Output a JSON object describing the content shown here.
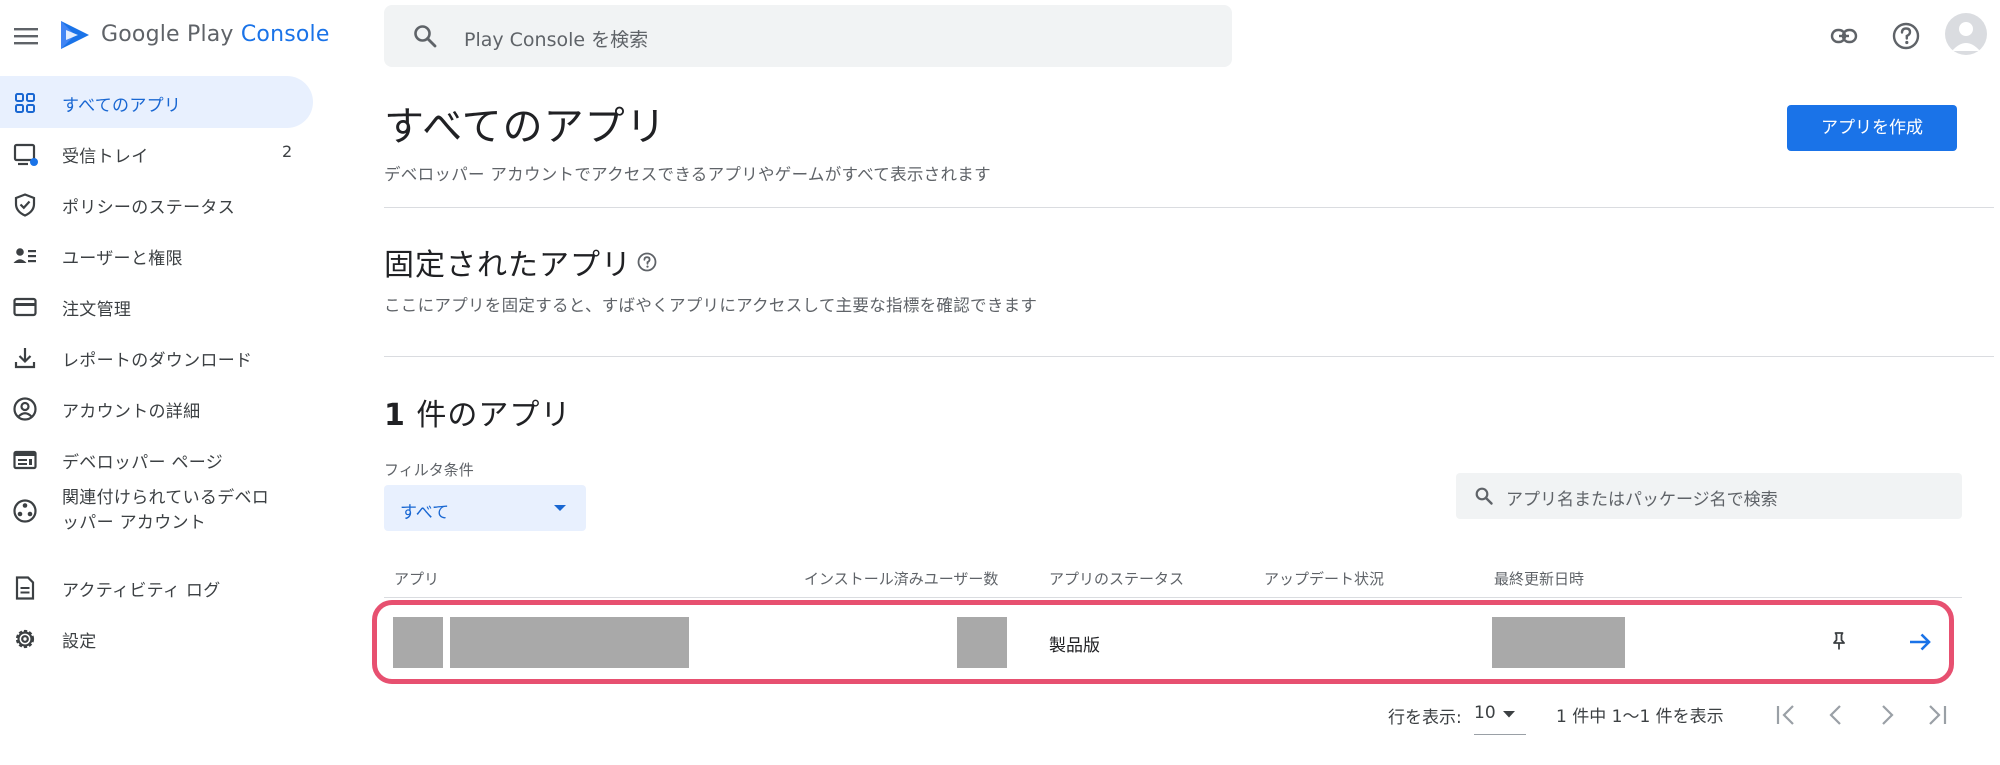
{
  "header": {
    "logo_text_main": "Google Play ",
    "logo_text_accent": "Console",
    "search_placeholder": "Play Console を検索"
  },
  "sidebar": {
    "items": [
      {
        "label": "すべてのアプリ",
        "icon": "grid-icon",
        "active": true
      },
      {
        "label": "受信トレイ",
        "icon": "inbox-icon",
        "badge": "2"
      },
      {
        "label": "ポリシーのステータス",
        "icon": "shield-check-icon"
      },
      {
        "label": "ユーザーと権限",
        "icon": "user-list-icon"
      },
      {
        "label": "注文管理",
        "icon": "credit-card-icon"
      },
      {
        "label": "レポートのダウンロード",
        "icon": "download-icon"
      },
      {
        "label": "アカウントの詳細",
        "icon": "account-circle-icon"
      },
      {
        "label": "デベロッパー ページ",
        "icon": "web-page-icon"
      },
      {
        "label_line1": "関連付けられているデベロ",
        "label_line2": "ッパー アカウント",
        "icon": "linked-accounts-icon"
      },
      {
        "label": "アクティビティ ログ",
        "icon": "document-icon"
      },
      {
        "label": "設定",
        "icon": "gear-icon"
      }
    ]
  },
  "main": {
    "title": "すべてのアプリ",
    "subtitle": "デベロッパー アカウントでアクセスできるアプリやゲームがすべて表示されます",
    "create_button": "アプリを作成",
    "pinned": {
      "title": "固定されたアプリ",
      "subtitle": "ここにアプリを固定すると、すばやくアプリにアクセスして主要な指標を確認できます"
    },
    "apps": {
      "count_title_num": "1",
      "count_title_text": "件のアプリ",
      "filter_label": "フィルタ条件",
      "filter_value": "すべて",
      "search_placeholder": "アプリ名またはパッケージ名で検索",
      "columns": [
        "アプリ",
        "インストール済みユーザー数",
        "アプリのステータス",
        "アップデート状況",
        "最終更新日時"
      ],
      "rows": [
        {
          "status": "製品版"
        }
      ]
    },
    "pagination": {
      "rows_label": "行を表示:",
      "rows_value": "10",
      "range_text": "1 件中 1〜1 件を表示"
    }
  },
  "colors": {
    "accent": "#1a73e8",
    "active_bg": "#e8f0fe",
    "highlight_border": "#e75070"
  }
}
